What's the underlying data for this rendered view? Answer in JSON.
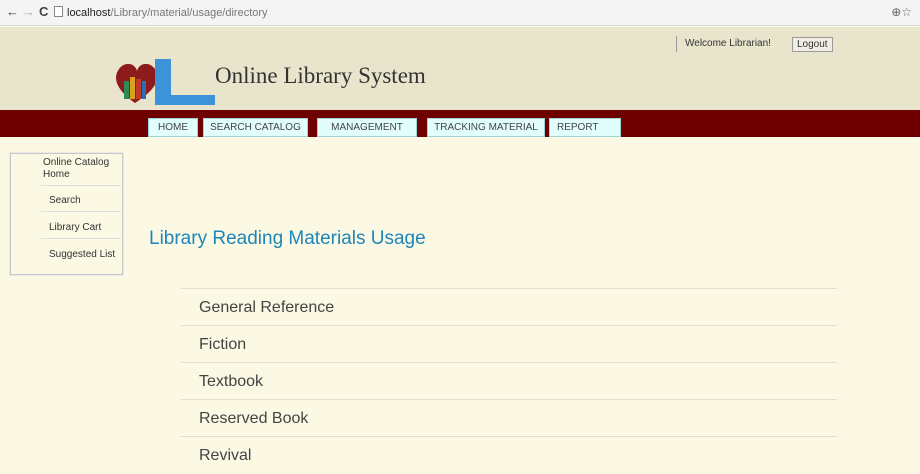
{
  "browser": {
    "url_host": "localhost",
    "url_path": "/Library/material/usage/directory",
    "back_icon": "←",
    "forward_icon": "→",
    "reload_icon": "C",
    "zoom_icon": "⊕☆"
  },
  "header": {
    "site_title": "Online Library System",
    "welcome_text": "Welcome Librarian!",
    "logout_label": "Logout"
  },
  "nav": {
    "items": [
      {
        "label": "HOME"
      },
      {
        "label": "SEARCH CATALOG"
      },
      {
        "label": "MANAGEMENT"
      },
      {
        "label": "TRACKING MATERIAL"
      },
      {
        "label": "REPORT"
      }
    ]
  },
  "side_menu": {
    "items": [
      {
        "label": "Online Catalog Home"
      },
      {
        "label": "Search"
      },
      {
        "label": "Library Cart"
      },
      {
        "label": "Suggested List"
      }
    ]
  },
  "main": {
    "heading": "Library Reading Materials Usage",
    "directory": [
      {
        "label": "General Reference"
      },
      {
        "label": "Fiction"
      },
      {
        "label": "Textbook"
      },
      {
        "label": "Reserved Book"
      },
      {
        "label": "Revival"
      }
    ]
  },
  "colors": {
    "nav_bar": "#6f0000",
    "heading": "#1e86b9",
    "page_bg": "#fbf8e4",
    "header_bg": "#e9e5cd"
  }
}
